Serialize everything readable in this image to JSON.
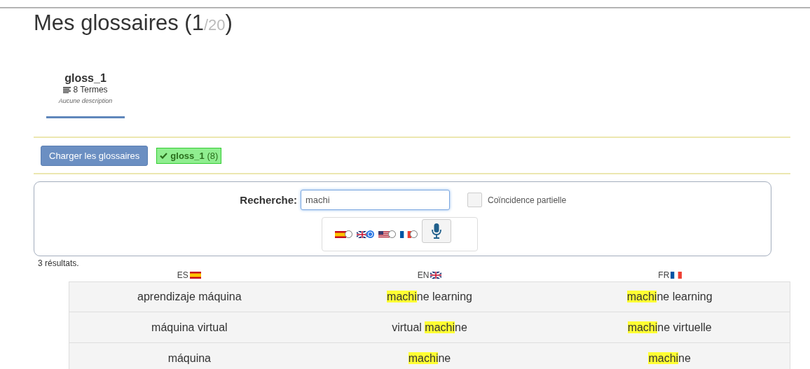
{
  "header": {
    "title": "Mes glossaires (1",
    "total": "/20)"
  },
  "glossaries": [
    {
      "name": "gloss_1",
      "terms": "8 Termes",
      "description": "Aucune description",
      "selected": true
    }
  ],
  "load_button": "Charger les glossaires",
  "loaded": [
    {
      "name": "gloss_1",
      "count": "(8)"
    }
  ],
  "search": {
    "label": "Recherche:",
    "value": "machi",
    "partial_match": {
      "label": "Coïncidence partielle",
      "checked": false
    },
    "languages": [
      {
        "kind": "es",
        "selected": false
      },
      {
        "kind": "gb",
        "selected": true
      },
      {
        "kind": "us",
        "selected": false
      },
      {
        "kind": "fr",
        "selected": false
      }
    ]
  },
  "results_count": "3 résultats.",
  "table": {
    "columns": [
      {
        "label": "ES",
        "kind": "es"
      },
      {
        "label": "EN",
        "kind": "gb"
      },
      {
        "label": "FR",
        "kind": "fr"
      }
    ],
    "rows": [
      [
        "aprendizaje máquina",
        "**machi**ne learning",
        "**machi**ne learning"
      ],
      [
        "máquina virtual",
        "virtual **machi**ne",
        "**machi**ne virtuelle"
      ],
      [
        "máquina",
        "**machi**ne",
        "**machi**ne"
      ]
    ]
  }
}
